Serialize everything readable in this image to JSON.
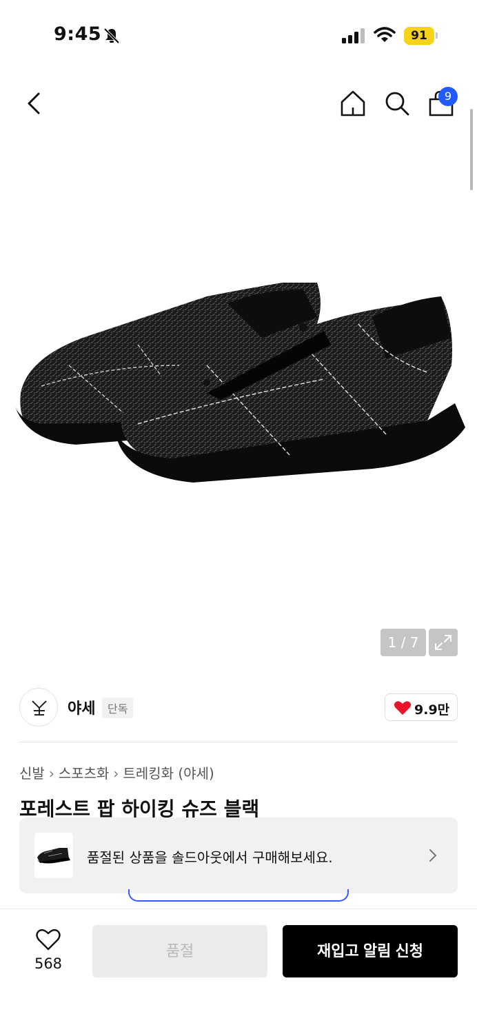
{
  "status_bar": {
    "time": "9:45",
    "battery": "91"
  },
  "nav": {
    "cart_count": "9"
  },
  "gallery": {
    "pager": "1 / 7"
  },
  "brand": {
    "name": "야세",
    "tag": "단독",
    "likes": "9.9만"
  },
  "breadcrumb": {
    "items": [
      "신발",
      "스포츠화",
      "트레킹화 (야세)"
    ]
  },
  "product": {
    "title": "포레스트 팝 하이킹 슈즈 블랙"
  },
  "soldout_banner": {
    "text": "품절된 상품을 솔드아웃에서 구매해보세요."
  },
  "bottom_bar": {
    "wish_count": "568",
    "soldout_label": "품절",
    "restock_label": "재입고 알림 신청"
  },
  "colors": {
    "accent_blue": "#1f5bff",
    "battery_yellow": "#f7d21a",
    "heart_red": "#e8152a"
  },
  "icons": [
    "bell-slash-icon",
    "signal-icon",
    "wifi-icon",
    "back-arrow-icon",
    "home-icon",
    "search-icon",
    "shopping-bag-icon",
    "expand-icon",
    "heart-icon",
    "chevron-right-icon"
  ]
}
